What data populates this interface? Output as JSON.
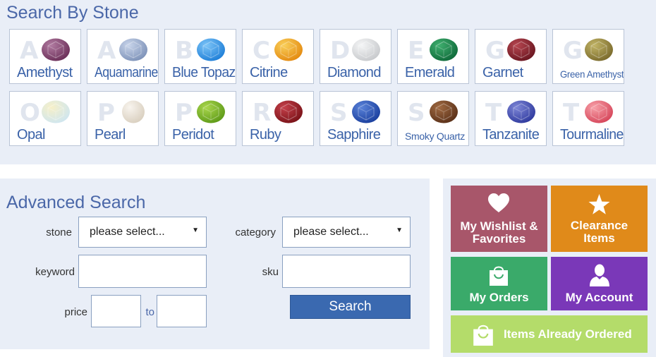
{
  "stone_search": {
    "title": "Search By Stone",
    "stones": [
      {
        "letter": "A",
        "name": "Amethyst",
        "color": "#6b2f58",
        "hi": "#b07aa0"
      },
      {
        "letter": "A",
        "name": "Aquamarine",
        "color": "#7d92b8",
        "hi": "#c8d4ea"
      },
      {
        "letter": "B",
        "name": "Blue Topaz",
        "color": "#1f7fd8",
        "hi": "#7cc4f7"
      },
      {
        "letter": "C",
        "name": "Citrine",
        "color": "#e48a10",
        "hi": "#f9cf5a"
      },
      {
        "letter": "D",
        "name": "Diamond",
        "color": "#c7c9cc",
        "hi": "#f4f5f6"
      },
      {
        "letter": "E",
        "name": "Emerald",
        "color": "#0f6a3a",
        "hi": "#3fae6e"
      },
      {
        "letter": "G",
        "name": "Garnet",
        "color": "#6a1620",
        "hi": "#b64650"
      },
      {
        "letter": "G",
        "name": "Green Amethyst",
        "color": "#7a6a2c",
        "hi": "#c1b466"
      },
      {
        "letter": "O",
        "name": "Opal",
        "color": "#cfe6ef",
        "hi": "#f7f0c8"
      },
      {
        "letter": "P",
        "name": "Pearl",
        "color": "#d9cfbf",
        "hi": "#f8f4ee"
      },
      {
        "letter": "P",
        "name": "Peridot",
        "color": "#5e9a18",
        "hi": "#a9d64c"
      },
      {
        "letter": "R",
        "name": "Ruby",
        "color": "#7a1218",
        "hi": "#c4404a"
      },
      {
        "letter": "S",
        "name": "Sapphire",
        "color": "#1a3f9e",
        "hi": "#5a82d8"
      },
      {
        "letter": "S",
        "name": "Smoky Quartz",
        "color": "#5a3018",
        "hi": "#a06a42"
      },
      {
        "letter": "T",
        "name": "Tanzanite",
        "color": "#2f3a9e",
        "hi": "#7e86d6"
      },
      {
        "letter": "T",
        "name": "Tourmaline",
        "color": "#d6465a",
        "hi": "#f7a0a8"
      }
    ]
  },
  "advanced_search": {
    "title": "Advanced Search",
    "stone_label": "stone",
    "stone_value": "please select...",
    "category_label": "category",
    "category_value": "please select...",
    "keyword_label": "keyword",
    "sku_label": "sku",
    "price_label": "price",
    "price_to_label": "to",
    "search_button": "Search"
  },
  "quick_links": {
    "wishlist": {
      "label": "My Wishlist & Favorites",
      "color": "#a8566a",
      "icon": "heart-icon"
    },
    "clearance": {
      "label": "Clearance Items",
      "color": "#e08a1a",
      "icon": "star-icon"
    },
    "orders": {
      "label": "My Orders",
      "color": "#3aaa6a",
      "icon": "shopping-bag-icon"
    },
    "account": {
      "label": "My Account",
      "color": "#7a38b8",
      "icon": "user-icon"
    },
    "already_ordered": {
      "label": "Items Already Ordered",
      "color": "#b4dc6a",
      "icon": "shopping-bag-icon"
    }
  }
}
